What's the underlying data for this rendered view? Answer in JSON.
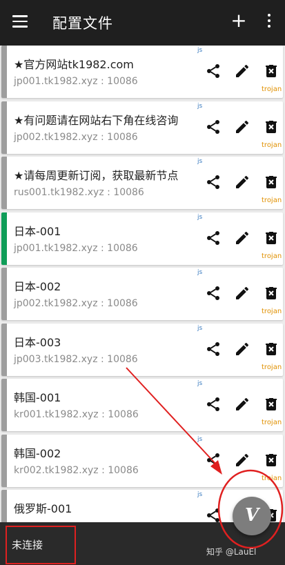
{
  "appbar": {
    "title": "配置文件",
    "add_glyph": "+",
    "menu_icon": "hamburger-menu-icon",
    "more_icon": "more-vert-icon"
  },
  "servers": [
    {
      "name": "★官方网站tk1982.com",
      "address": "jp001.tk1982.xyz : 10086",
      "script": "js",
      "protocol": "trojan",
      "active": false
    },
    {
      "name": "★有问题请在网站右下角在线咨询",
      "address": "jp002.tk1982.xyz : 10086",
      "script": "js",
      "protocol": "trojan",
      "active": false
    },
    {
      "name": "★请每周更新订阅，获取最新节点",
      "address": "rus001.tk1982.xyz : 10086",
      "script": "js",
      "protocol": "trojan",
      "active": false
    },
    {
      "name": "日本-001",
      "address": "jp001.tk1982.xyz : 10086",
      "script": "js",
      "protocol": "trojan",
      "active": true
    },
    {
      "name": "日本-002",
      "address": "jp002.tk1982.xyz : 10086",
      "script": "js",
      "protocol": "trojan",
      "active": false
    },
    {
      "name": "日本-003",
      "address": "jp003.tk1982.xyz : 10086",
      "script": "js",
      "protocol": "trojan",
      "active": false
    },
    {
      "name": "韩国-001",
      "address": "kr001.tk1982.xyz : 10086",
      "script": "js",
      "protocol": "trojan",
      "active": false
    },
    {
      "name": "韩国-002",
      "address": "kr002.tk1982.xyz : 10086",
      "script": "js",
      "protocol": "trojan",
      "active": false
    },
    {
      "name": "俄罗斯-001",
      "address": "",
      "script": "js",
      "protocol": "",
      "active": false
    }
  ],
  "fab": {
    "glyph": "V"
  },
  "bottombar": {
    "status": "未连接",
    "watermark": "知乎 @LauEl"
  },
  "colors": {
    "appbar": "#1f1f1f",
    "active_indicator": "#0f9d58",
    "inactive_indicator": "#9e9e9e",
    "protocol_text": "#e09000",
    "script_tag": "#3a7bbf",
    "annotation_red": "#e02020"
  }
}
